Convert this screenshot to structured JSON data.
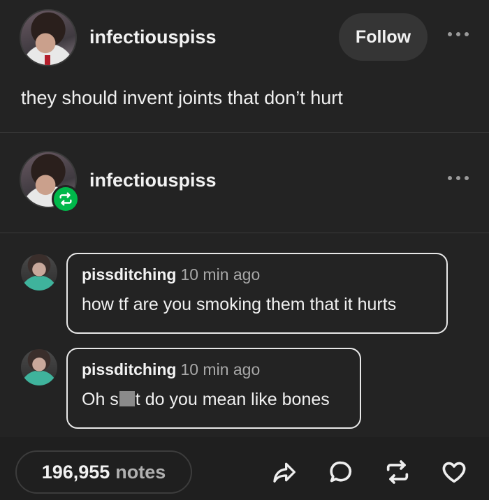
{
  "post": {
    "username": "infectiouspiss",
    "follow_label": "Follow",
    "text": "they should invent joints that don’t hurt"
  },
  "reblog": {
    "username": "infectiouspiss"
  },
  "comments": [
    {
      "username": "pissditching",
      "time": "10 min ago",
      "text": "how tf are you smoking them that it hurts"
    },
    {
      "username": "pissditching",
      "time": "10 min ago",
      "text_before": "Oh s",
      "text_after": "t do you mean like bones"
    }
  ],
  "footer": {
    "notes_count": "196,955",
    "notes_label": "notes",
    "icons": [
      "share-icon",
      "reply-icon",
      "reblog-icon",
      "like-icon"
    ]
  },
  "colors": {
    "background": "#232323",
    "reblog_badge": "#00b84a"
  }
}
